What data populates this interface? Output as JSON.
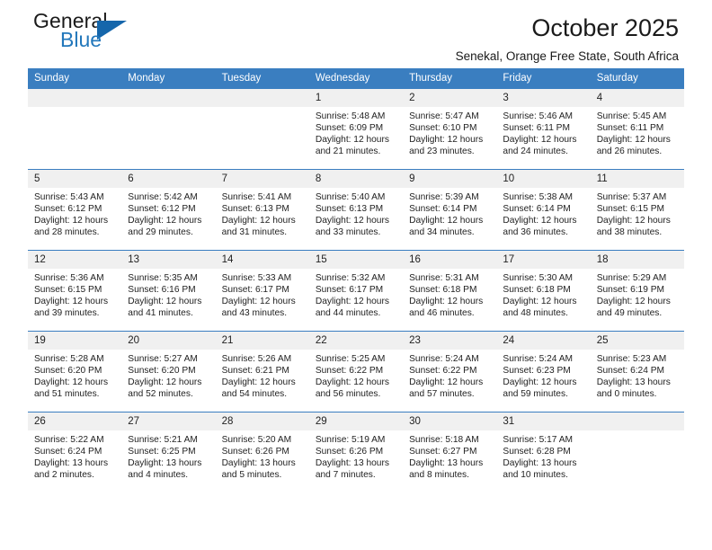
{
  "brand": {
    "name_part1": "General",
    "name_part2": "Blue",
    "logo_icon": "triangle-logo-icon"
  },
  "header": {
    "title": "October 2025",
    "subtitle": "Senekal, Orange Free State, South Africa"
  },
  "colors": {
    "header_blue": "#3a7ec0",
    "brand_blue": "#2277bb",
    "logo_blue": "#1566ab",
    "daynum_band": "#f0f0f0",
    "text": "#222222"
  },
  "weekdays": [
    "Sunday",
    "Monday",
    "Tuesday",
    "Wednesday",
    "Thursday",
    "Friday",
    "Saturday"
  ],
  "labels": {
    "sunrise_prefix": "Sunrise:",
    "sunset_prefix": "Sunset:",
    "daylight_prefix": "Daylight:"
  },
  "weeks": [
    [
      {
        "day": "",
        "empty": true
      },
      {
        "day": "",
        "empty": true
      },
      {
        "day": "",
        "empty": true
      },
      {
        "day": "1",
        "sunrise": "Sunrise: 5:48 AM",
        "sunset": "Sunset: 6:09 PM",
        "daylight1": "Daylight: 12 hours",
        "daylight2": "and 21 minutes."
      },
      {
        "day": "2",
        "sunrise": "Sunrise: 5:47 AM",
        "sunset": "Sunset: 6:10 PM",
        "daylight1": "Daylight: 12 hours",
        "daylight2": "and 23 minutes."
      },
      {
        "day": "3",
        "sunrise": "Sunrise: 5:46 AM",
        "sunset": "Sunset: 6:11 PM",
        "daylight1": "Daylight: 12 hours",
        "daylight2": "and 24 minutes."
      },
      {
        "day": "4",
        "sunrise": "Sunrise: 5:45 AM",
        "sunset": "Sunset: 6:11 PM",
        "daylight1": "Daylight: 12 hours",
        "daylight2": "and 26 minutes."
      }
    ],
    [
      {
        "day": "5",
        "sunrise": "Sunrise: 5:43 AM",
        "sunset": "Sunset: 6:12 PM",
        "daylight1": "Daylight: 12 hours",
        "daylight2": "and 28 minutes."
      },
      {
        "day": "6",
        "sunrise": "Sunrise: 5:42 AM",
        "sunset": "Sunset: 6:12 PM",
        "daylight1": "Daylight: 12 hours",
        "daylight2": "and 29 minutes."
      },
      {
        "day": "7",
        "sunrise": "Sunrise: 5:41 AM",
        "sunset": "Sunset: 6:13 PM",
        "daylight1": "Daylight: 12 hours",
        "daylight2": "and 31 minutes."
      },
      {
        "day": "8",
        "sunrise": "Sunrise: 5:40 AM",
        "sunset": "Sunset: 6:13 PM",
        "daylight1": "Daylight: 12 hours",
        "daylight2": "and 33 minutes."
      },
      {
        "day": "9",
        "sunrise": "Sunrise: 5:39 AM",
        "sunset": "Sunset: 6:14 PM",
        "daylight1": "Daylight: 12 hours",
        "daylight2": "and 34 minutes."
      },
      {
        "day": "10",
        "sunrise": "Sunrise: 5:38 AM",
        "sunset": "Sunset: 6:14 PM",
        "daylight1": "Daylight: 12 hours",
        "daylight2": "and 36 minutes."
      },
      {
        "day": "11",
        "sunrise": "Sunrise: 5:37 AM",
        "sunset": "Sunset: 6:15 PM",
        "daylight1": "Daylight: 12 hours",
        "daylight2": "and 38 minutes."
      }
    ],
    [
      {
        "day": "12",
        "sunrise": "Sunrise: 5:36 AM",
        "sunset": "Sunset: 6:15 PM",
        "daylight1": "Daylight: 12 hours",
        "daylight2": "and 39 minutes."
      },
      {
        "day": "13",
        "sunrise": "Sunrise: 5:35 AM",
        "sunset": "Sunset: 6:16 PM",
        "daylight1": "Daylight: 12 hours",
        "daylight2": "and 41 minutes."
      },
      {
        "day": "14",
        "sunrise": "Sunrise: 5:33 AM",
        "sunset": "Sunset: 6:17 PM",
        "daylight1": "Daylight: 12 hours",
        "daylight2": "and 43 minutes."
      },
      {
        "day": "15",
        "sunrise": "Sunrise: 5:32 AM",
        "sunset": "Sunset: 6:17 PM",
        "daylight1": "Daylight: 12 hours",
        "daylight2": "and 44 minutes."
      },
      {
        "day": "16",
        "sunrise": "Sunrise: 5:31 AM",
        "sunset": "Sunset: 6:18 PM",
        "daylight1": "Daylight: 12 hours",
        "daylight2": "and 46 minutes."
      },
      {
        "day": "17",
        "sunrise": "Sunrise: 5:30 AM",
        "sunset": "Sunset: 6:18 PM",
        "daylight1": "Daylight: 12 hours",
        "daylight2": "and 48 minutes."
      },
      {
        "day": "18",
        "sunrise": "Sunrise: 5:29 AM",
        "sunset": "Sunset: 6:19 PM",
        "daylight1": "Daylight: 12 hours",
        "daylight2": "and 49 minutes."
      }
    ],
    [
      {
        "day": "19",
        "sunrise": "Sunrise: 5:28 AM",
        "sunset": "Sunset: 6:20 PM",
        "daylight1": "Daylight: 12 hours",
        "daylight2": "and 51 minutes."
      },
      {
        "day": "20",
        "sunrise": "Sunrise: 5:27 AM",
        "sunset": "Sunset: 6:20 PM",
        "daylight1": "Daylight: 12 hours",
        "daylight2": "and 52 minutes."
      },
      {
        "day": "21",
        "sunrise": "Sunrise: 5:26 AM",
        "sunset": "Sunset: 6:21 PM",
        "daylight1": "Daylight: 12 hours",
        "daylight2": "and 54 minutes."
      },
      {
        "day": "22",
        "sunrise": "Sunrise: 5:25 AM",
        "sunset": "Sunset: 6:22 PM",
        "daylight1": "Daylight: 12 hours",
        "daylight2": "and 56 minutes."
      },
      {
        "day": "23",
        "sunrise": "Sunrise: 5:24 AM",
        "sunset": "Sunset: 6:22 PM",
        "daylight1": "Daylight: 12 hours",
        "daylight2": "and 57 minutes."
      },
      {
        "day": "24",
        "sunrise": "Sunrise: 5:24 AM",
        "sunset": "Sunset: 6:23 PM",
        "daylight1": "Daylight: 12 hours",
        "daylight2": "and 59 minutes."
      },
      {
        "day": "25",
        "sunrise": "Sunrise: 5:23 AM",
        "sunset": "Sunset: 6:24 PM",
        "daylight1": "Daylight: 13 hours",
        "daylight2": "and 0 minutes."
      }
    ],
    [
      {
        "day": "26",
        "sunrise": "Sunrise: 5:22 AM",
        "sunset": "Sunset: 6:24 PM",
        "daylight1": "Daylight: 13 hours",
        "daylight2": "and 2 minutes."
      },
      {
        "day": "27",
        "sunrise": "Sunrise: 5:21 AM",
        "sunset": "Sunset: 6:25 PM",
        "daylight1": "Daylight: 13 hours",
        "daylight2": "and 4 minutes."
      },
      {
        "day": "28",
        "sunrise": "Sunrise: 5:20 AM",
        "sunset": "Sunset: 6:26 PM",
        "daylight1": "Daylight: 13 hours",
        "daylight2": "and 5 minutes."
      },
      {
        "day": "29",
        "sunrise": "Sunrise: 5:19 AM",
        "sunset": "Sunset: 6:26 PM",
        "daylight1": "Daylight: 13 hours",
        "daylight2": "and 7 minutes."
      },
      {
        "day": "30",
        "sunrise": "Sunrise: 5:18 AM",
        "sunset": "Sunset: 6:27 PM",
        "daylight1": "Daylight: 13 hours",
        "daylight2": "and 8 minutes."
      },
      {
        "day": "31",
        "sunrise": "Sunrise: 5:17 AM",
        "sunset": "Sunset: 6:28 PM",
        "daylight1": "Daylight: 13 hours",
        "daylight2": "and 10 minutes."
      },
      {
        "day": "",
        "empty": true
      }
    ]
  ]
}
